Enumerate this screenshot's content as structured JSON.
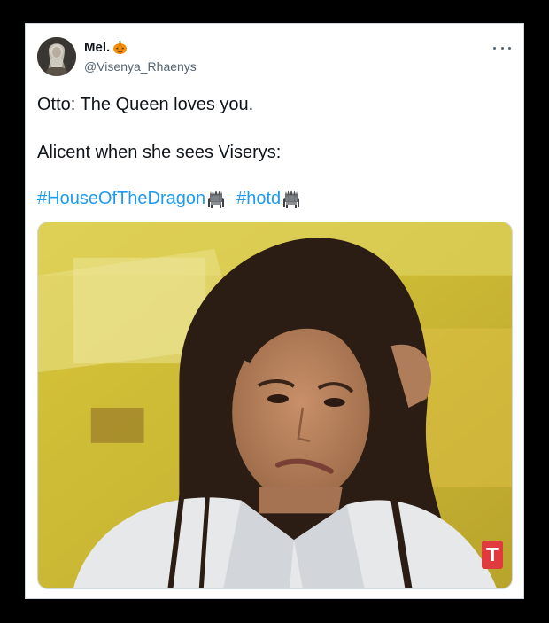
{
  "tweet": {
    "author": {
      "display_name": "Mel.",
      "name_emoji": "pumpkin-icon",
      "handle": "@Visenya_Rhaenys",
      "avatar": "avatar"
    },
    "menu_icon": "more-options-icon",
    "text_lines": [
      "Otto: The Queen loves you.",
      "Alicent when she sees Viserys:"
    ],
    "hashtags": [
      {
        "text": "#HouseOfTheDragon",
        "emoji": "throne-icon"
      },
      {
        "text": "#hotd",
        "emoji": "throne-icon"
      }
    ],
    "media": {
      "type": "gif",
      "watermark": "T",
      "watermark_color": "#e0393e"
    }
  },
  "colors": {
    "link": "#1d9bf0",
    "text_primary": "#0f1419",
    "text_secondary": "#536471",
    "background": "#000000",
    "card": "#ffffff"
  }
}
